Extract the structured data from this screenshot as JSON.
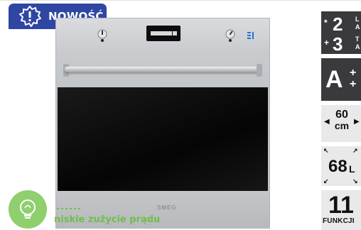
{
  "badge": {
    "label": "NOWOŚĆ",
    "icon": "exclamation-burst-icon",
    "color": "#2f46a3"
  },
  "product": {
    "brand_on_oven": "SMEG",
    "energy_note": "niskie zużycie prądu",
    "energy_note_color": "#6fbf4a"
  },
  "features": {
    "class_1": {
      "sign": "*",
      "number": "2",
      "letters": "L\nA"
    },
    "class_2": {
      "sign": "+",
      "number": "3",
      "letters": "T\nA"
    },
    "energy": {
      "letter": "A",
      "plus": "+"
    },
    "width": {
      "left_arrow": "◀",
      "value": "60",
      "unit": "cm",
      "right_arrow": "▶"
    },
    "volume": {
      "value": "68",
      "unit": "L"
    },
    "functions": {
      "value": "11",
      "label": "FUNKCJI"
    }
  },
  "colors": {
    "dark_tile": "#3a3a3c",
    "light_tile": "#e9e9ea"
  }
}
